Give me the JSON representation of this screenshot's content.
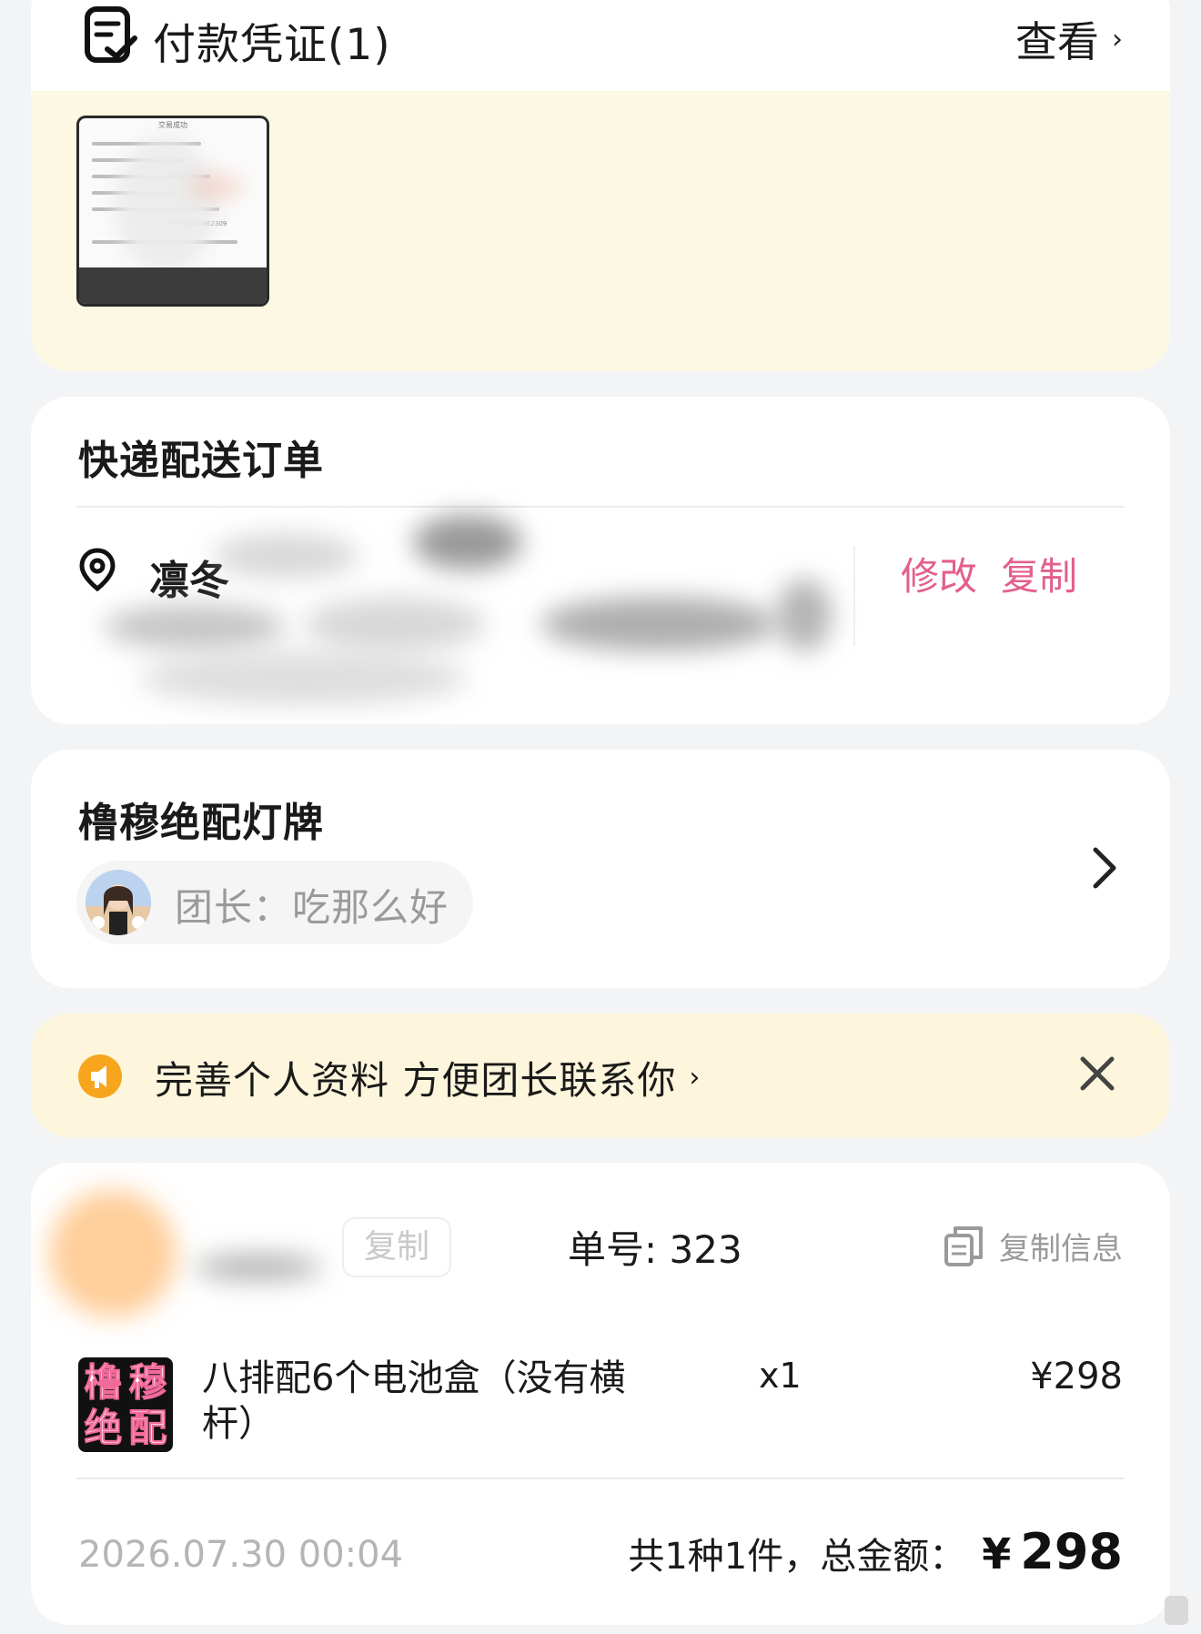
{
  "payment_proof": {
    "title": "付款凭证(1)",
    "view_label": "查看",
    "thumb_heading": "交易成功",
    "thumb_number": "50631400362309"
  },
  "express": {
    "title": "快递配送订单",
    "recipient_name": "凛冬",
    "edit_label": "修改",
    "copy_label": "复制"
  },
  "group": {
    "title": "橹穆绝配灯牌",
    "leader_text": "团长：吃那么好"
  },
  "notice": {
    "text": "完善个人资料 方便团长联系你"
  },
  "order": {
    "copy_label": "复制",
    "order_no": "单号: 323",
    "copy_info_label": "复制信息",
    "product": {
      "logo_chars": [
        "橹",
        "穆",
        "绝",
        "配"
      ],
      "name": "八排配6个电池盒（没有横杆）",
      "qty": "x1",
      "price": "¥298"
    },
    "time": "2026.07.30 00:04",
    "summary_label": "共1种1件，总金额：",
    "currency": "¥",
    "total": "298"
  },
  "colors": {
    "accent_pink": "#e35f8e",
    "notice_bg": "#fdf6dc",
    "notice_icon": "#f6a51c",
    "proof_bg": "#fdf8e1"
  }
}
